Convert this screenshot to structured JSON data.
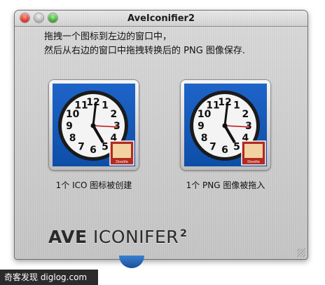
{
  "window": {
    "title": "AveIconifier2",
    "buttons": [
      "close-button",
      "minimize-button",
      "zoom-button"
    ]
  },
  "instructions": {
    "line1": "拖拽一个图标到左边的窗口中，",
    "line2": "然后从右边的窗口中拖拽转换后的 PNG 图像保存."
  },
  "wells": {
    "left_label": "1个 ICO 图标被创建",
    "right_label": "1个 PNG 图像被拖入"
  },
  "icon": {
    "name": "clock-icon",
    "badge_icon": "doodle-badge-icon",
    "badge_text": "Doodle",
    "dial_numbers": [
      "12",
      "1",
      "2",
      "3",
      "4",
      "5",
      "6",
      "7",
      "8",
      "9",
      "10",
      "11"
    ]
  },
  "brand": {
    "part1": "AVE",
    "part2": "ICONIFER",
    "part3": "2"
  },
  "watermark": {
    "text": "奇客发现 diglog.com"
  },
  "colors": {
    "close": "#d8281a",
    "minimize": "#a9a9a9",
    "zoom": "#2f9e22",
    "icon_bg": "#1e64c8"
  }
}
